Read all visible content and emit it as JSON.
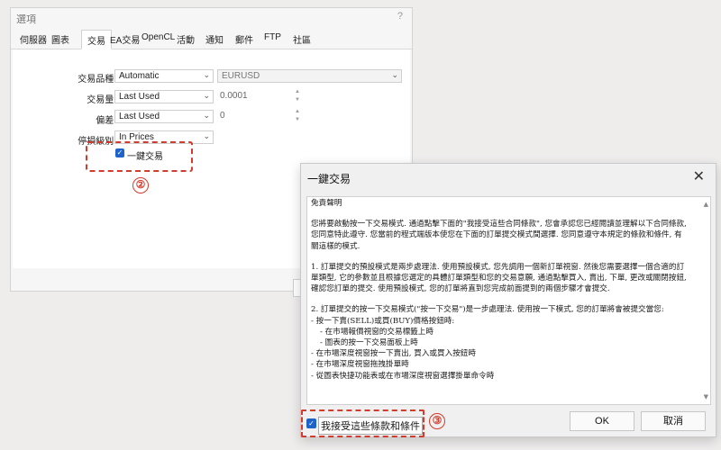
{
  "options_window": {
    "title": "選項",
    "help_glyph": "?",
    "tabs": [
      "伺服器",
      "圖表",
      "交易",
      "EA交易",
      "OpenCL",
      "活動",
      "通知",
      "郵件",
      "FTP",
      "社區"
    ],
    "active_tab": "交易",
    "form": {
      "symbol_label": "交易品種:",
      "symbol_value": "Automatic",
      "symbol_right_value": "EURUSD",
      "volume_label": "交易量:",
      "volume_value": "Last Used",
      "volume_number": "0.0001",
      "deviation_label": "偏差:",
      "deviation_value": "Last Used",
      "deviation_number": "0",
      "sl_level_label": "停損級別:",
      "sl_level_value": "In Prices",
      "one_click_label": "一鍵交易",
      "one_click_checked": true
    },
    "annotation_mark": "②"
  },
  "dialog": {
    "title": "一鍵交易",
    "close_glyph": "✕",
    "terms": {
      "heading": "免責聲明",
      "para1": "您將要啟動按一下交易模式. 通過點擊下面的\"我接受這些合同條款\", 您會承認您已經閱讀並理解以下合同條款, 您同意特此遵守. 您當前的程式端版本使您在下面的訂單提交模式間選擇. 您同意遵守本規定的條款和條件, 有關這樣的模式.",
      "para2": "1. 訂單提交的預設模式是兩步處理法. 使用預設模式, 您先調用一個新訂單視窗. 然後您需要選擇一個合適的訂單類型, 它的參數並且根據您選定的具體訂單類型和您的交易意願, 通過點擊買入, 賣出, 下單, 更改或關閉按鈕, 確認您訂單的提交. 使用預設模式, 您的訂單將直到您完成前面提到的兩個步驟才會提交.",
      "para3": "2. 訂單提交的按一下交易模式(\"按一下交易\")是一步處理法. 使用按一下模式, 您的訂單將會被提交當您:",
      "bullets": [
        "- 按一下賣(SELL)或買(BUY)價格按鈕時:",
        "- 在市場報價視窗的交易標籤上時",
        "- 圖表的按一下交易面板上時",
        "- 在市場深度視窗按一下賣出, 買入或買入按鈕時",
        "- 在市場深度視窗拖拽掛單時",
        "- 從圖表快捷功能表或在市場深度視窗選擇掛單命令時"
      ]
    },
    "agree_label": "我接受這些條款和條件",
    "agree_checked": true,
    "ok_label": "OK",
    "cancel_label": "取消",
    "annotation_mark": "③"
  },
  "colors": {
    "accent_check": "#1d63c9",
    "annotation_red": "#d23b2d"
  }
}
